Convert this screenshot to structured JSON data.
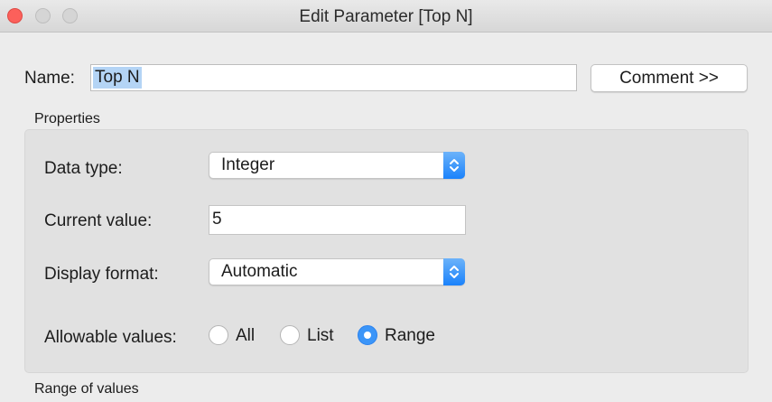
{
  "window": {
    "title": "Edit Parameter [Top N]"
  },
  "name": {
    "label": "Name:",
    "value": "Top N",
    "comment_button": "Comment >>"
  },
  "properties": {
    "section_label": "Properties",
    "data_type": {
      "label": "Data type:",
      "value": "Integer"
    },
    "current_value": {
      "label": "Current value:",
      "value": "5"
    },
    "display_format": {
      "label": "Display format:",
      "value": "Automatic"
    },
    "allowable_values": {
      "label": "Allowable values:",
      "options": [
        {
          "label": "All",
          "selected": false
        },
        {
          "label": "List",
          "selected": false
        },
        {
          "label": "Range",
          "selected": true
        }
      ]
    }
  },
  "range": {
    "section_label": "Range of values"
  },
  "colors": {
    "accent": "#3b95f8",
    "close_button": "#fc605b",
    "selection_highlight": "#b4d4f5"
  }
}
